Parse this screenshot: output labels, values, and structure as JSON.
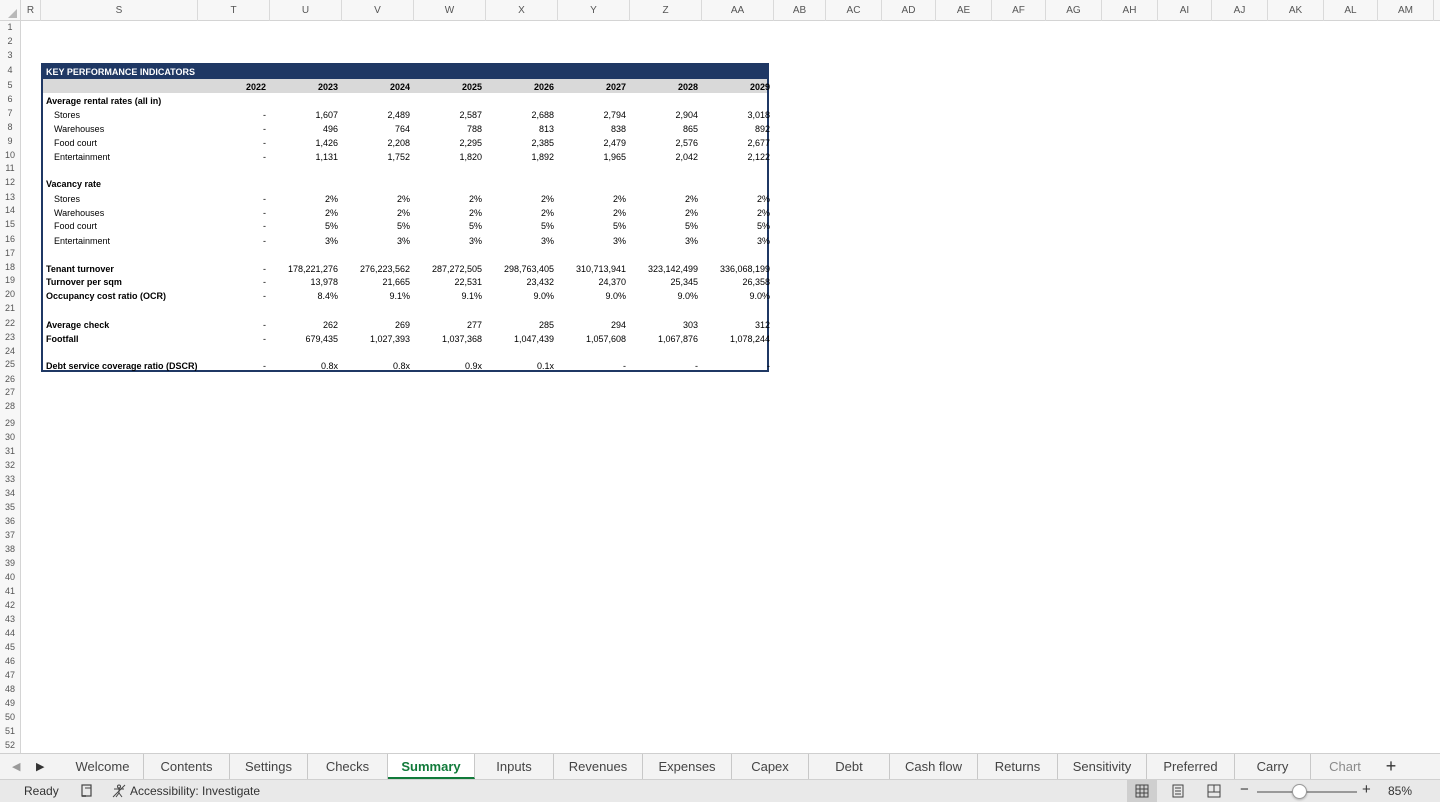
{
  "columns": [
    "R",
    "S",
    "T",
    "U",
    "V",
    "W",
    "X",
    "Y",
    "Z",
    "AA",
    "AB",
    "AC",
    "AD",
    "AE",
    "AF",
    "AG",
    "AH",
    "AI",
    "AJ",
    "AK",
    "AL",
    "AM"
  ],
  "rows": [
    "1",
    "2",
    "3",
    "4",
    "5",
    "6",
    "7",
    "8",
    "9",
    "10",
    "11",
    "12",
    "13",
    "14",
    "15",
    "16",
    "17",
    "18",
    "19",
    "20",
    "21",
    "22",
    "23",
    "24",
    "25",
    "26",
    "27",
    "28",
    "29",
    "30",
    "31",
    "32",
    "33",
    "34",
    "35",
    "36",
    "37",
    "38",
    "39",
    "40",
    "41",
    "42",
    "43",
    "44",
    "45",
    "46",
    "47",
    "48",
    "49",
    "50",
    "51",
    "52"
  ],
  "kpi": {
    "title": "KEY PERFORMANCE INDICATORS",
    "years": [
      "2022",
      "2023",
      "2024",
      "2025",
      "2026",
      "2027",
      "2028",
      "2029"
    ],
    "rows": [
      {
        "label": "Average rental rates (all in)",
        "bold": true,
        "values": []
      },
      {
        "label": "Stores",
        "values": [
          "-",
          "1,607",
          "2,489",
          "2,587",
          "2,688",
          "2,794",
          "2,904",
          "3,018"
        ]
      },
      {
        "label": "Warehouses",
        "values": [
          "-",
          "496",
          "764",
          "788",
          "813",
          "838",
          "865",
          "892"
        ]
      },
      {
        "label": "Food court",
        "values": [
          "-",
          "1,426",
          "2,208",
          "2,295",
          "2,385",
          "2,479",
          "2,576",
          "2,677"
        ]
      },
      {
        "label": "Entertainment",
        "values": [
          "-",
          "1,131",
          "1,752",
          "1,820",
          "1,892",
          "1,965",
          "2,042",
          "2,122"
        ]
      },
      {
        "label": "Vacancy rate",
        "bold": true,
        "values": []
      },
      {
        "label": "Stores",
        "values": [
          "-",
          "2%",
          "2%",
          "2%",
          "2%",
          "2%",
          "2%",
          "2%"
        ]
      },
      {
        "label": "Warehouses",
        "values": [
          "-",
          "2%",
          "2%",
          "2%",
          "2%",
          "2%",
          "2%",
          "2%"
        ]
      },
      {
        "label": "Food court",
        "values": [
          "-",
          "5%",
          "5%",
          "5%",
          "5%",
          "5%",
          "5%",
          "5%"
        ]
      },
      {
        "label": "Entertainment",
        "values": [
          "-",
          "3%",
          "3%",
          "3%",
          "3%",
          "3%",
          "3%",
          "3%"
        ]
      },
      {
        "label": "Tenant turnover",
        "bold": true,
        "values": [
          "-",
          "178,221,276",
          "276,223,562",
          "287,272,505",
          "298,763,405",
          "310,713,941",
          "323,142,499",
          "336,068,199"
        ]
      },
      {
        "label": "Turnover per sqm",
        "bold": true,
        "values": [
          "-",
          "13,978",
          "21,665",
          "22,531",
          "23,432",
          "24,370",
          "25,345",
          "26,358"
        ]
      },
      {
        "label": "Occupancy cost ratio (OCR)",
        "bold": true,
        "values": [
          "-",
          "8.4%",
          "9.1%",
          "9.1%",
          "9.0%",
          "9.0%",
          "9.0%",
          "9.0%"
        ]
      },
      {
        "label": "Average check",
        "bold": true,
        "values": [
          "-",
          "262",
          "269",
          "277",
          "285",
          "294",
          "303",
          "312"
        ]
      },
      {
        "label": "Footfall",
        "bold": true,
        "values": [
          "-",
          "679,435",
          "1,027,393",
          "1,037,368",
          "1,047,439",
          "1,057,608",
          "1,067,876",
          "1,078,244"
        ]
      },
      {
        "label": "Debt service coverage ratio (DSCR)",
        "bold": true,
        "values": [
          "-",
          "0.8x",
          "0.8x",
          "0.9x",
          "0.1x",
          "-",
          "-",
          "-"
        ]
      }
    ]
  },
  "tabs": [
    "Welcome",
    "Contents",
    "Settings",
    "Checks",
    "Summary",
    "Inputs",
    "Revenues",
    "Expenses",
    "Capex",
    "Debt",
    "Cash flow",
    "Returns",
    "Sensitivity",
    "Preferred",
    "Carry",
    "Chart"
  ],
  "active_tab": "Summary",
  "status": {
    "ready": "Ready",
    "accessibility": "Accessibility: Investigate",
    "zoom": "85%"
  }
}
